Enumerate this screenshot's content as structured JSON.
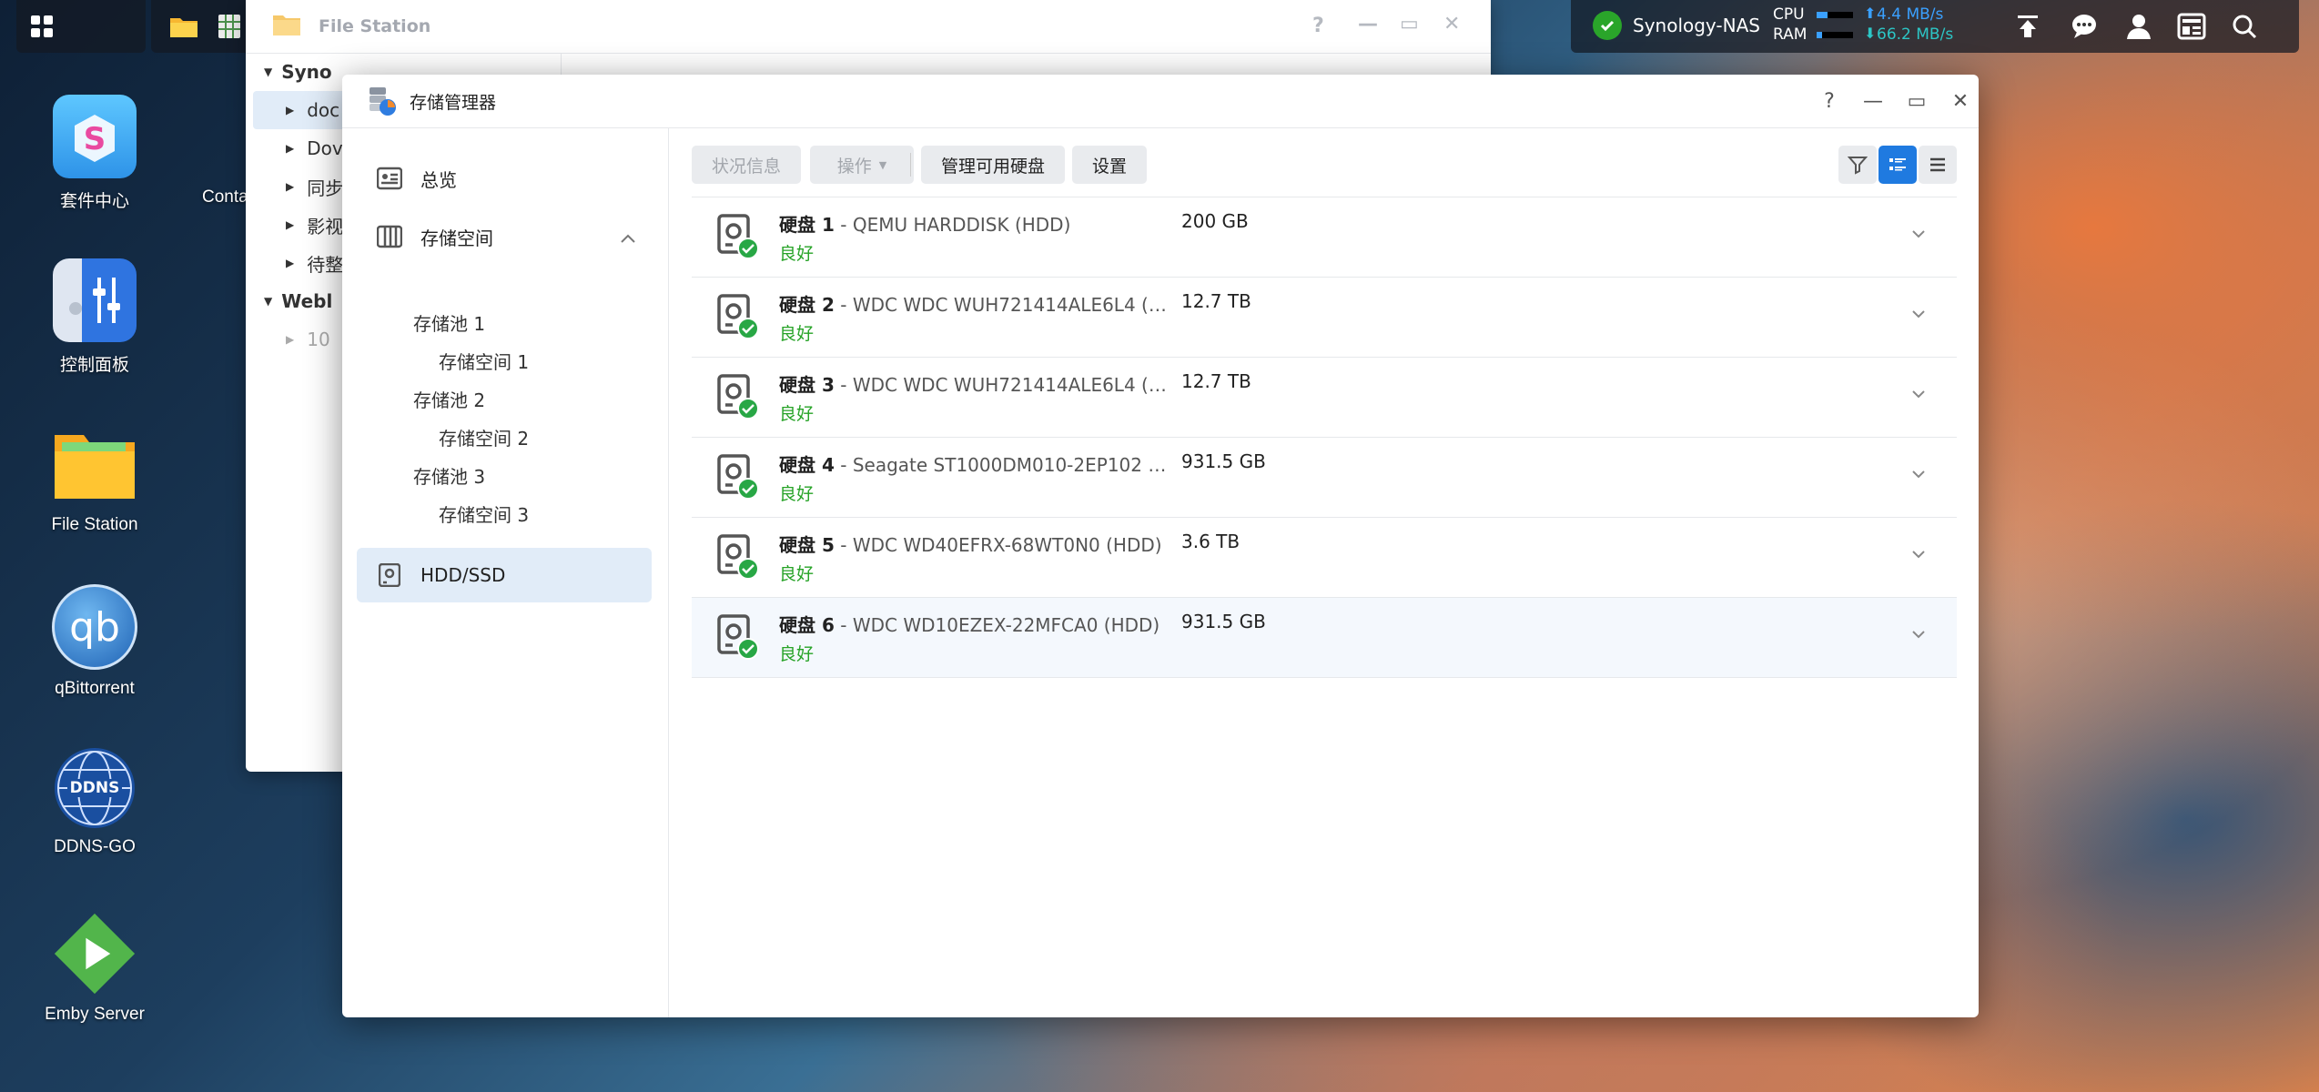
{
  "taskbar": {
    "left_icons": [
      "apps-grid-icon",
      "folder-icon",
      "spreadsheet-icon"
    ],
    "system": {
      "nas_name": "Synology-NAS",
      "cpu_label": "CPU",
      "ram_label": "RAM",
      "upload": "4.4 MB/s",
      "download": "66.2 MB/s"
    },
    "right_icons": [
      "upload-icon",
      "chat-icon",
      "user-icon",
      "widgets-icon",
      "search-icon"
    ]
  },
  "desktop": {
    "icons": [
      {
        "label": "套件中心",
        "icon": "package-center-icon"
      },
      {
        "label": "控制面板",
        "icon": "control-panel-icon"
      },
      {
        "label": "File Station",
        "icon": "file-station-icon"
      },
      {
        "label": "qBittorrent",
        "icon": "qbittorrent-icon",
        "glyph": "qb"
      },
      {
        "label": "DDNS-GO",
        "icon": "ddns-icon",
        "glyph": "DDNS"
      },
      {
        "label": "Emby Server",
        "icon": "emby-icon"
      },
      {
        "label": "Conta",
        "icon": "container-icon"
      }
    ]
  },
  "file_station": {
    "title": "File Station",
    "tree": [
      {
        "label": "Syno",
        "bold": true,
        "expanded": true
      },
      {
        "label": "doc",
        "child": true,
        "selected": true
      },
      {
        "label": "Dov",
        "child": true
      },
      {
        "label": "同步",
        "child": true
      },
      {
        "label": "影视",
        "child": true
      },
      {
        "label": "待整",
        "child": true
      },
      {
        "label": "Webl",
        "bold": true,
        "expanded": true
      },
      {
        "label": "10",
        "child": true,
        "muted": true
      }
    ]
  },
  "storage_manager": {
    "title": "存储管理器",
    "window_controls": {
      "help": "?",
      "minimize": "—",
      "maximize": "▭",
      "close": "✕"
    },
    "sidebar": {
      "overview": "总览",
      "storage": "存储空间",
      "pools": [
        {
          "pool": "存储池 1",
          "volume": "存储空间 1"
        },
        {
          "pool": "存储池 2",
          "volume": "存储空间 2"
        },
        {
          "pool": "存储池 3",
          "volume": "存储空间 3"
        }
      ],
      "hdd": "HDD/SSD"
    },
    "toolbar": {
      "status_info": "状况信息",
      "actions": "操作",
      "manage_disks": "管理可用硬盘",
      "settings": "设置"
    },
    "disks": [
      {
        "label": "硬盘 1",
        "model": " - QEMU HARDDISK (HDD)",
        "size": "200 GB",
        "status": "良好"
      },
      {
        "label": "硬盘 2",
        "model": " - WDC WDC WUH721414ALE6L4 (H...",
        "size": "12.7 TB",
        "status": "良好"
      },
      {
        "label": "硬盘 3",
        "model": " - WDC WDC WUH721414ALE6L4 (H...",
        "size": "12.7 TB",
        "status": "良好"
      },
      {
        "label": "硬盘 4",
        "model": " - Seagate ST1000DM010-2EP102 (...",
        "size": "931.5 GB",
        "status": "良好"
      },
      {
        "label": "硬盘 5",
        "model": " - WDC WD40EFRX-68WT0N0 (HDD)",
        "size": "3.6 TB",
        "status": "良好"
      },
      {
        "label": "硬盘 6",
        "model": " - WDC WD10EZEX-22MFCA0 (HDD)",
        "size": "931.5 GB",
        "status": "良好"
      }
    ]
  },
  "colors": {
    "accent": "#1f7ae0",
    "ok": "#27a327",
    "selected_bg": "#e1ecf8"
  }
}
